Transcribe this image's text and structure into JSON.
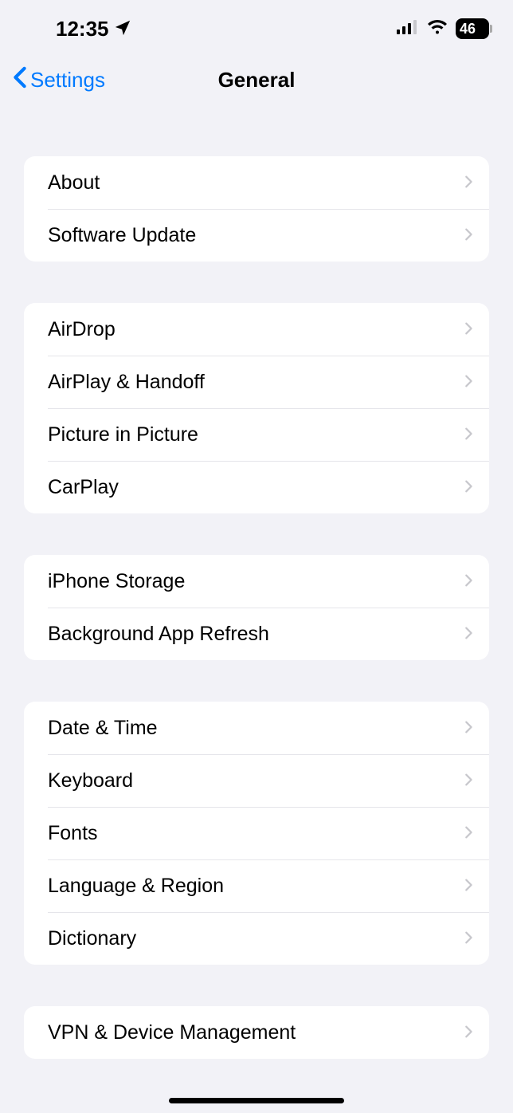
{
  "statusBar": {
    "time": "12:35",
    "battery": "46"
  },
  "nav": {
    "back": "Settings",
    "title": "General"
  },
  "groups": [
    {
      "items": [
        {
          "label": "About",
          "name": "row-about"
        },
        {
          "label": "Software Update",
          "name": "row-software-update"
        }
      ]
    },
    {
      "items": [
        {
          "label": "AirDrop",
          "name": "row-airdrop"
        },
        {
          "label": "AirPlay & Handoff",
          "name": "row-airplay-handoff"
        },
        {
          "label": "Picture in Picture",
          "name": "row-picture-in-picture"
        },
        {
          "label": "CarPlay",
          "name": "row-carplay"
        }
      ]
    },
    {
      "items": [
        {
          "label": "iPhone Storage",
          "name": "row-iphone-storage"
        },
        {
          "label": "Background App Refresh",
          "name": "row-background-app-refresh"
        }
      ]
    },
    {
      "items": [
        {
          "label": "Date & Time",
          "name": "row-date-time"
        },
        {
          "label": "Keyboard",
          "name": "row-keyboard"
        },
        {
          "label": "Fonts",
          "name": "row-fonts"
        },
        {
          "label": "Language & Region",
          "name": "row-language-region"
        },
        {
          "label": "Dictionary",
          "name": "row-dictionary"
        }
      ]
    },
    {
      "items": [
        {
          "label": "VPN & Device Management",
          "name": "row-vpn-device-management"
        }
      ]
    }
  ]
}
